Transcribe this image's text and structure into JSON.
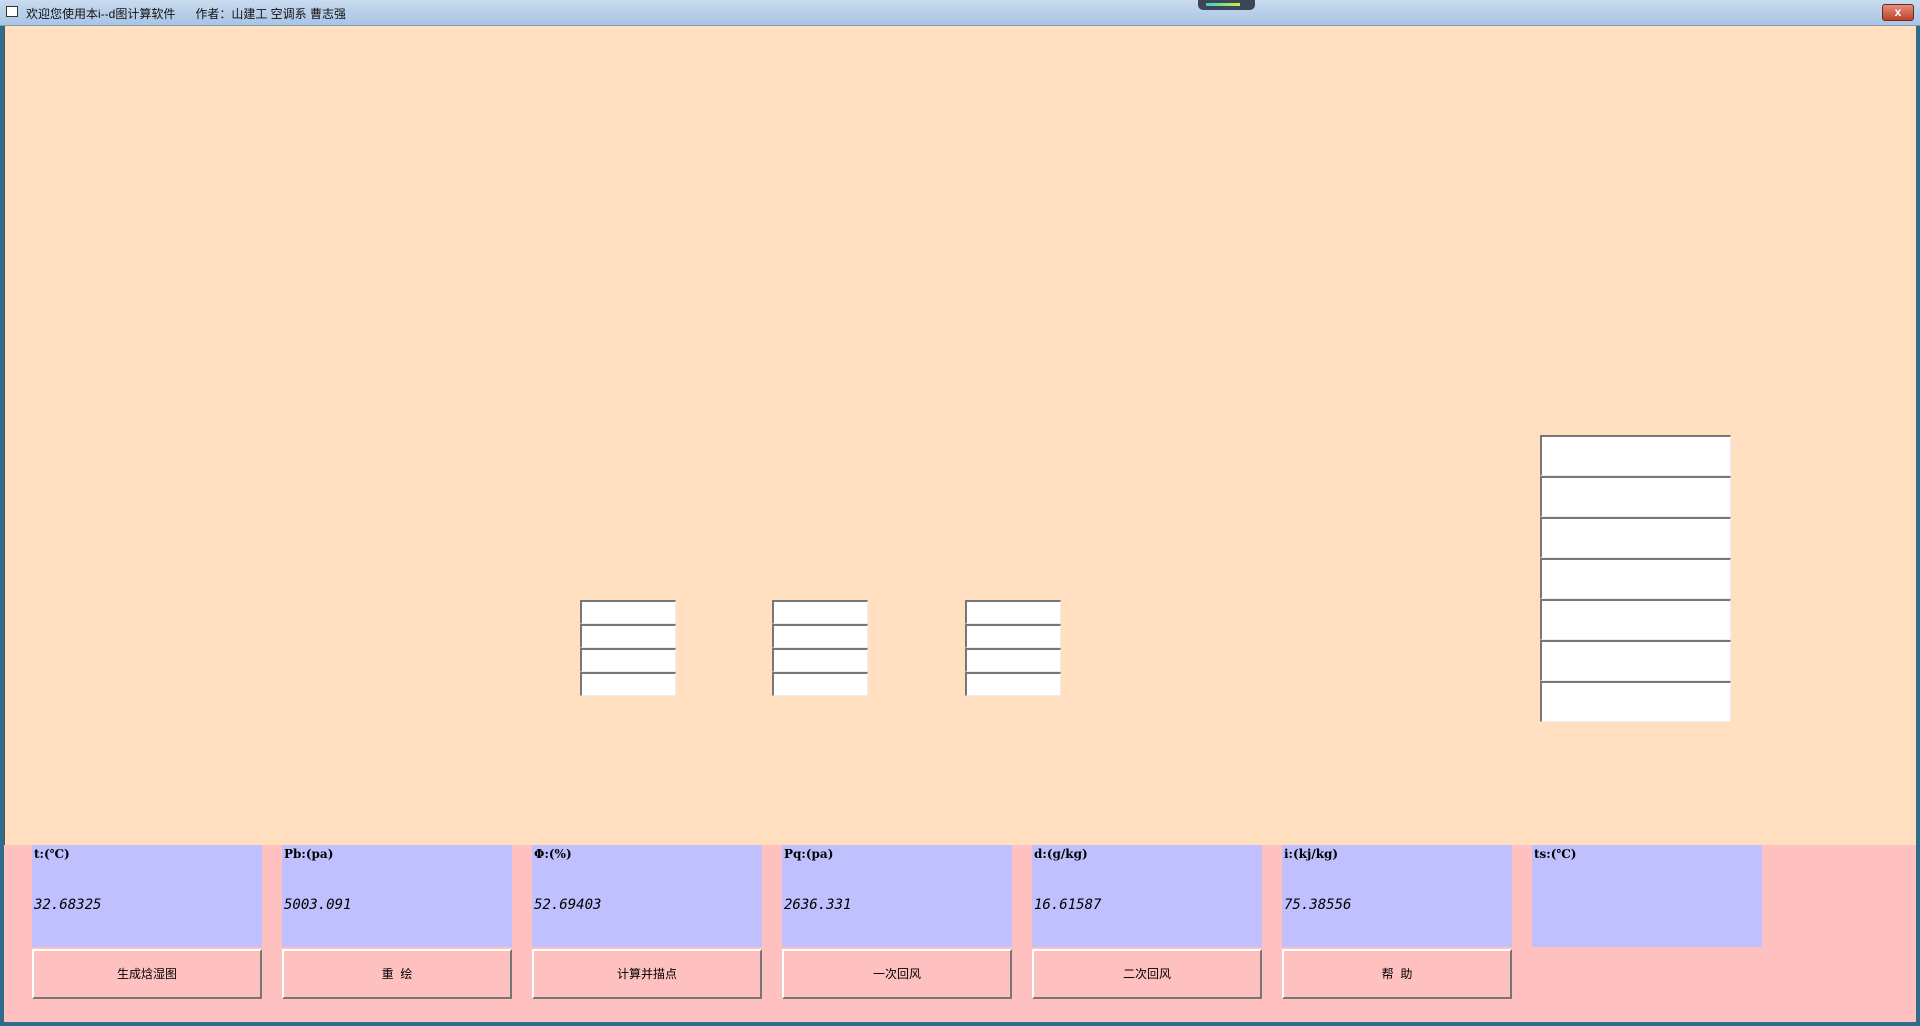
{
  "window": {
    "title": "欢迎您使用本i--d图计算软件      作者：山建工 空调系 曹志强",
    "close_label": "x"
  },
  "panels": [
    {
      "label": "t:(℃)",
      "value": "32.68325"
    },
    {
      "label": "Pb:(pa)",
      "value": "5003.091"
    },
    {
      "label": "Φ:(%)",
      "value": "52.69403"
    },
    {
      "label": "Pq:(pa)",
      "value": "2636.331"
    },
    {
      "label": "d:(g/kg)",
      "value": "16.61587"
    },
    {
      "label": "i:(kj/kg)",
      "value": "75.38556"
    },
    {
      "label": "ts:(℃)",
      "value": ""
    }
  ],
  "buttons": [
    "生成焓湿图",
    "重  绘",
    "计算并描点",
    "一次回风",
    "二次回风",
    "帮  助"
  ],
  "colors": {
    "canvas": "#ffdfbf",
    "bottom": "#ffc0c0",
    "panel": "#c0c0ff"
  }
}
